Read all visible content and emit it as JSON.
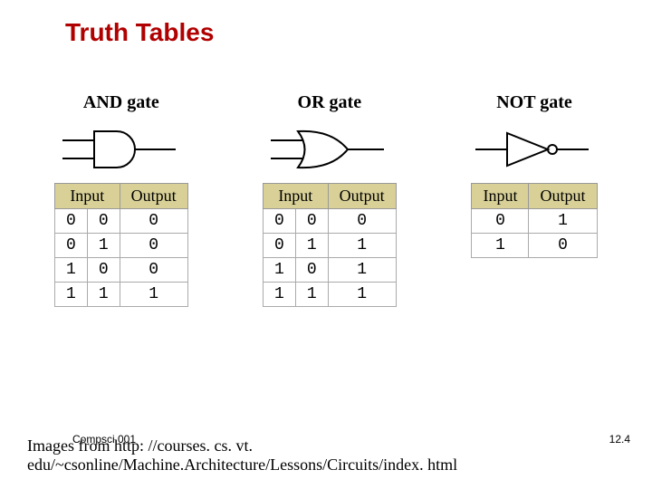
{
  "title": "Truth Tables",
  "gates": {
    "and": {
      "label": "AND gate",
      "headers": {
        "input": "Input",
        "output": "Output"
      },
      "rows": [
        {
          "a": "0",
          "b": "0",
          "out": "0"
        },
        {
          "a": "0",
          "b": "1",
          "out": "0"
        },
        {
          "a": "1",
          "b": "0",
          "out": "0"
        },
        {
          "a": "1",
          "b": "1",
          "out": "1"
        }
      ]
    },
    "or": {
      "label": "OR gate",
      "headers": {
        "input": "Input",
        "output": "Output"
      },
      "rows": [
        {
          "a": "0",
          "b": "0",
          "out": "0"
        },
        {
          "a": "0",
          "b": "1",
          "out": "1"
        },
        {
          "a": "1",
          "b": "0",
          "out": "1"
        },
        {
          "a": "1",
          "b": "1",
          "out": "1"
        }
      ]
    },
    "not": {
      "label": "NOT gate",
      "headers": {
        "input": "Input",
        "output": "Output"
      },
      "rows": [
        {
          "a": "0",
          "out": "1"
        },
        {
          "a": "1",
          "out": "0"
        }
      ]
    }
  },
  "footer": {
    "course": "Compsci 001",
    "page": "12.4"
  },
  "credits": "Images from http: //courses. cs. vt. edu/~csonline/Machine.Architecture/Lessons/Circuits/index. html"
}
